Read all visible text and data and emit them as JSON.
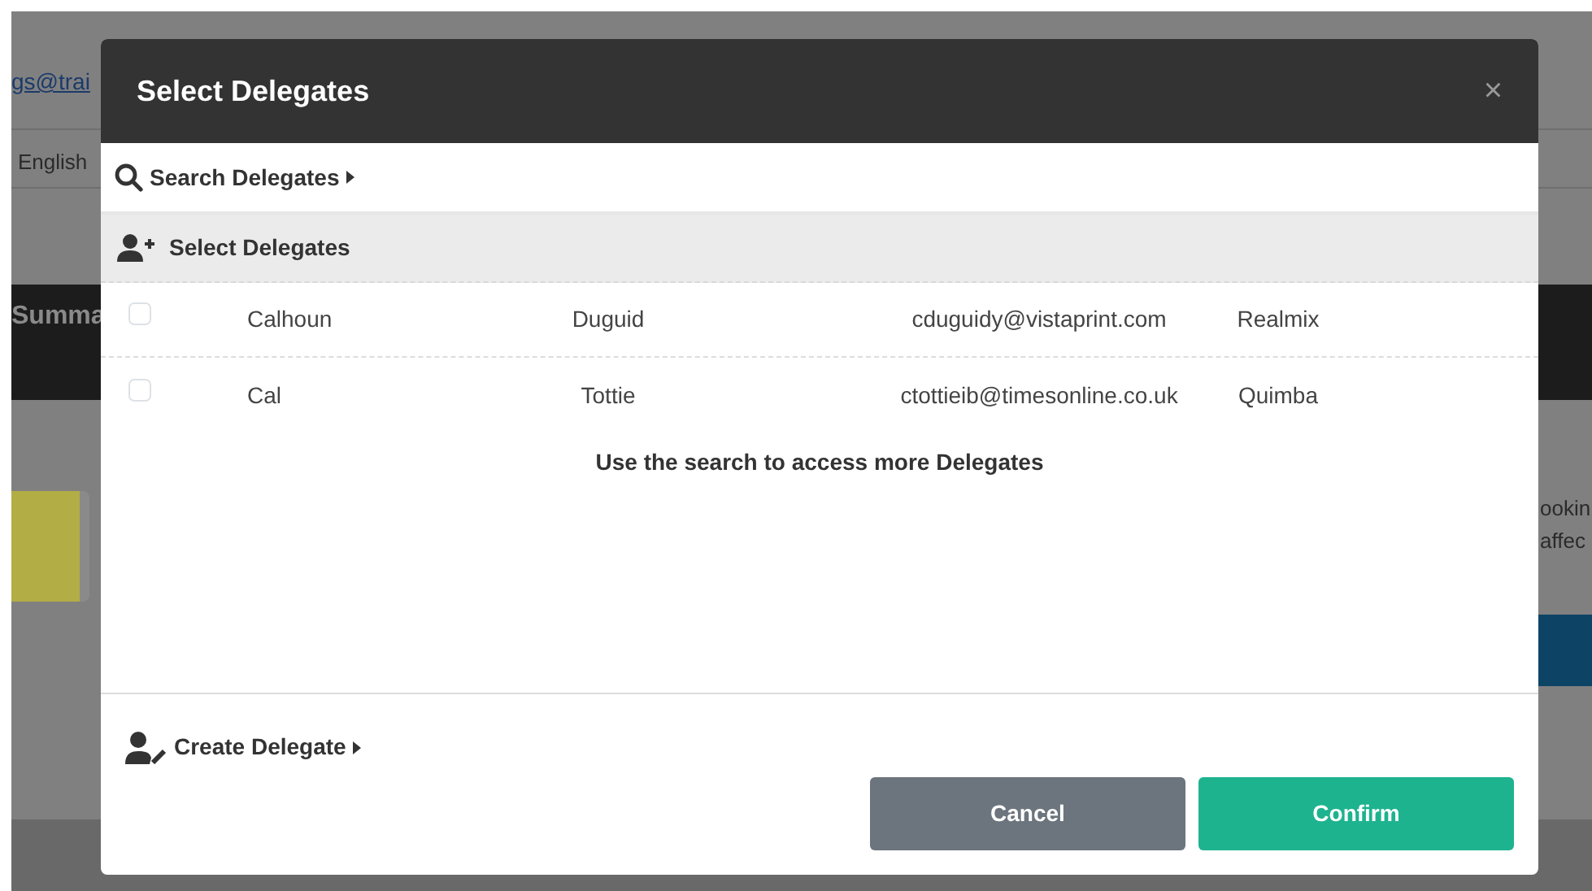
{
  "background": {
    "email_link": "gs@trai",
    "language": "English",
    "banner_title": "Summa",
    "notice_lines": [
      "ookin",
      "affec"
    ]
  },
  "modal": {
    "title": "Select Delegates",
    "close": "×",
    "search_toggle": "Search Delegates",
    "select_header": "Select Delegates",
    "delegates": [
      {
        "first_name": "Calhoun",
        "last_name": "Duguid",
        "email": "cduguidy@vistaprint.com",
        "company": "Realmix",
        "checked": false
      },
      {
        "first_name": "Cal",
        "last_name": "Tottie",
        "email": "ctottieib@timesonline.co.uk",
        "company": "Quimba",
        "checked": false
      }
    ],
    "hint": "Use the search to access more Delegates",
    "create_toggle": "Create Delegate",
    "buttons": [
      {
        "label": "Cancel",
        "kind": "secondary"
      },
      {
        "label": "Confirm",
        "kind": "primary"
      }
    ]
  }
}
